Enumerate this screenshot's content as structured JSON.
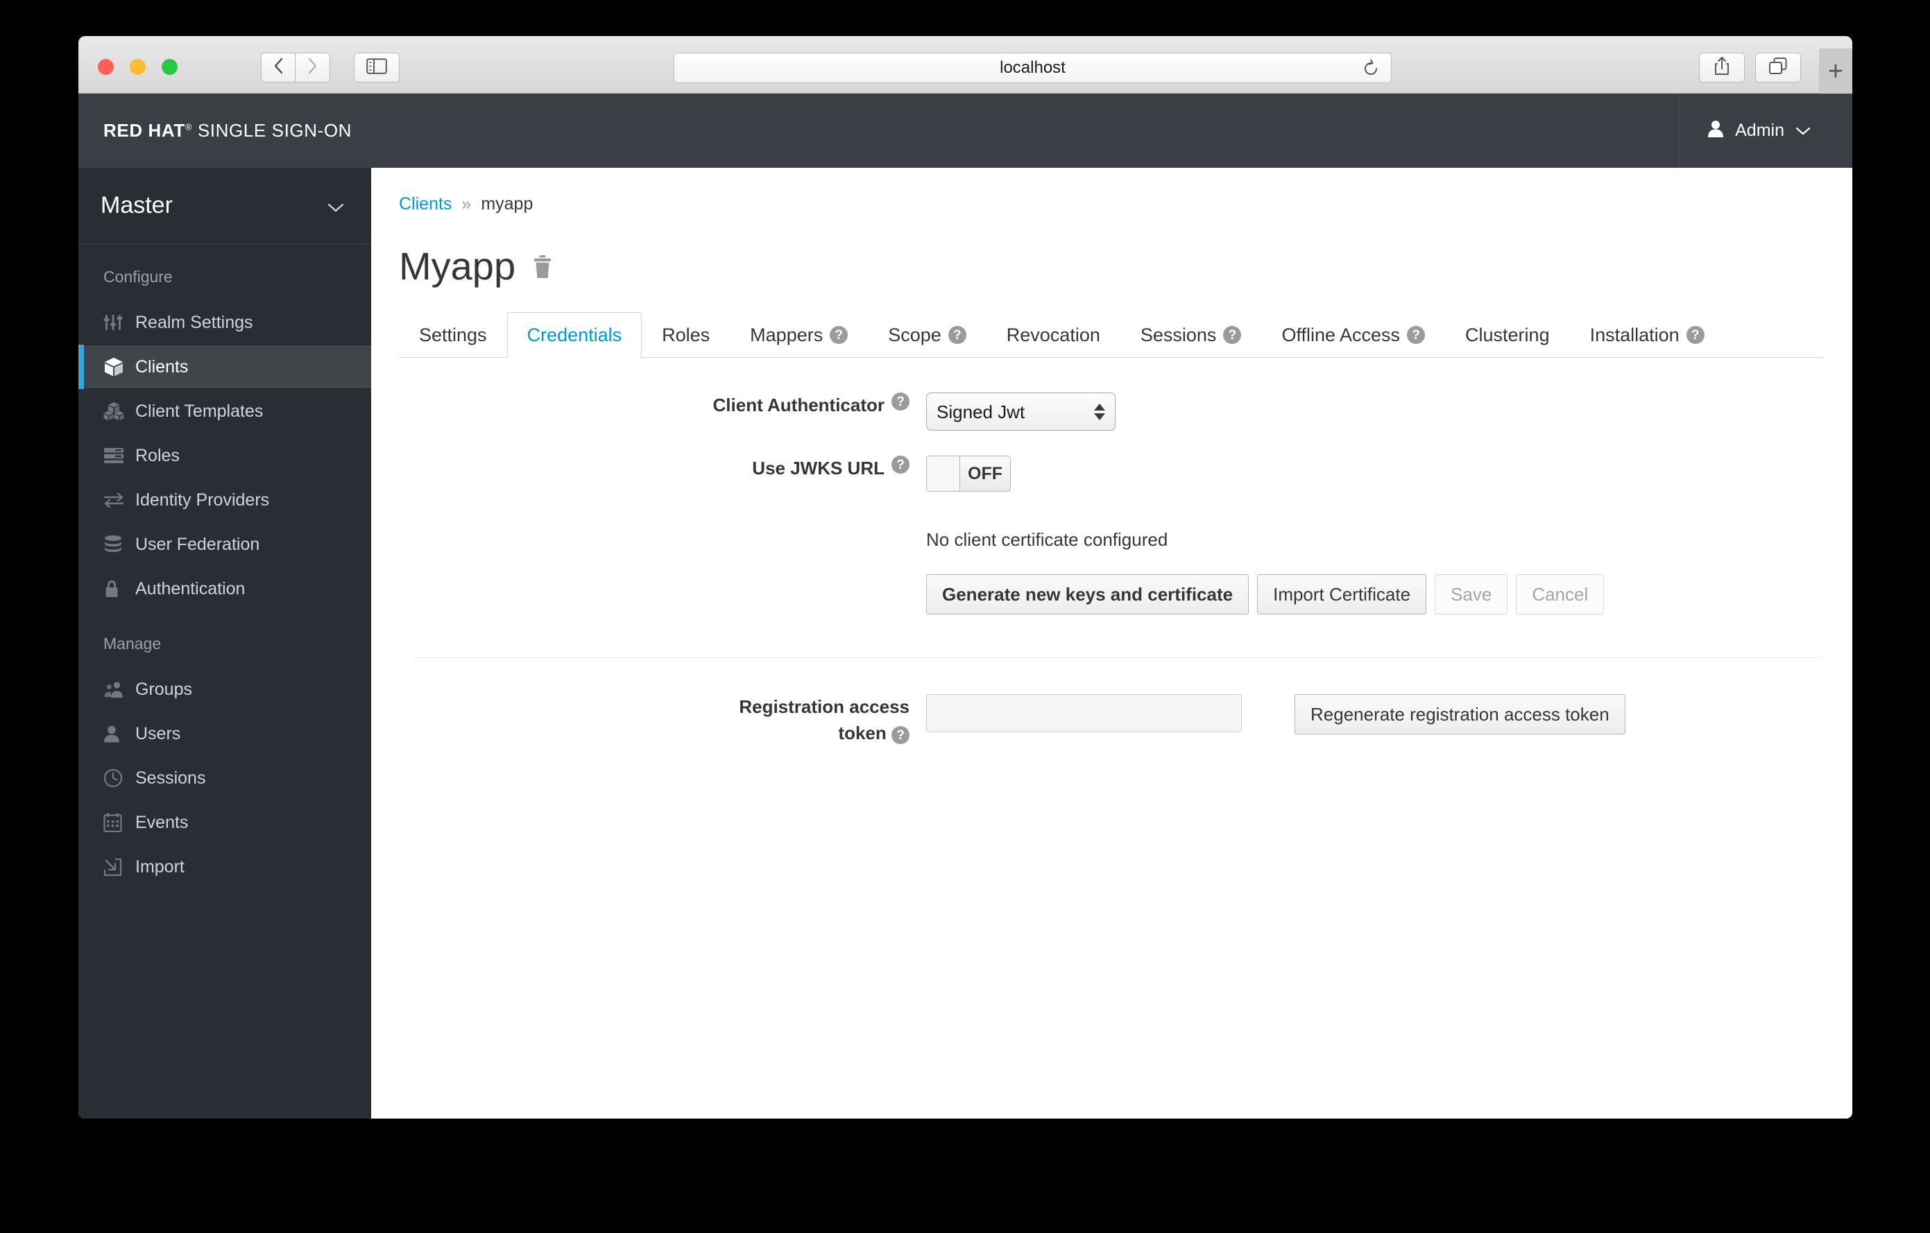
{
  "browser": {
    "url": "localhost",
    "back_icon": "chevron-left-icon",
    "forward_icon": "chevron-right-icon",
    "sidebar_icon": "sidebar-toggle-icon",
    "reload_icon": "reload-icon",
    "share_icon": "share-icon",
    "tabs_icon": "tab-overview-icon",
    "new_tab_label": "+"
  },
  "masthead": {
    "brand_bold": "RED HAT",
    "brand_reg": "®",
    "brand_light": "SINGLE SIGN-ON",
    "user_label": "Admin",
    "user_icon": "user-icon",
    "chevron_icon": "chevron-down-icon"
  },
  "sidebar": {
    "realm": "Master",
    "realm_chevron": "chevron-down-icon",
    "sections": [
      {
        "title": "Configure",
        "items": [
          {
            "label": "Realm Settings",
            "icon": "sliders-icon",
            "active": false
          },
          {
            "label": "Clients",
            "icon": "cube-icon",
            "active": true
          },
          {
            "label": "Client Templates",
            "icon": "cubes-icon",
            "active": false
          },
          {
            "label": "Roles",
            "icon": "list-icon",
            "active": false
          },
          {
            "label": "Identity Providers",
            "icon": "exchange-icon",
            "active": false
          },
          {
            "label": "User Federation",
            "icon": "database-icon",
            "active": false
          },
          {
            "label": "Authentication",
            "icon": "lock-icon",
            "active": false
          }
        ]
      },
      {
        "title": "Manage",
        "items": [
          {
            "label": "Groups",
            "icon": "group-icon",
            "active": false
          },
          {
            "label": "Users",
            "icon": "user-icon",
            "active": false
          },
          {
            "label": "Sessions",
            "icon": "clock-icon",
            "active": false
          },
          {
            "label": "Events",
            "icon": "calendar-icon",
            "active": false
          },
          {
            "label": "Import",
            "icon": "import-icon",
            "active": false
          }
        ]
      }
    ]
  },
  "breadcrumb": {
    "parent": "Clients",
    "separator": "»",
    "current": "myapp"
  },
  "page": {
    "title": "Myapp",
    "delete_icon": "trash-icon"
  },
  "tabs": [
    {
      "label": "Settings",
      "help": false,
      "active": false
    },
    {
      "label": "Credentials",
      "help": false,
      "active": true
    },
    {
      "label": "Roles",
      "help": false,
      "active": false
    },
    {
      "label": "Mappers",
      "help": true,
      "active": false
    },
    {
      "label": "Scope",
      "help": true,
      "active": false
    },
    {
      "label": "Revocation",
      "help": false,
      "active": false
    },
    {
      "label": "Sessions",
      "help": true,
      "active": false
    },
    {
      "label": "Offline Access",
      "help": true,
      "active": false
    },
    {
      "label": "Clustering",
      "help": false,
      "active": false
    },
    {
      "label": "Installation",
      "help": true,
      "active": false
    }
  ],
  "form": {
    "client_authenticator": {
      "label": "Client Authenticator",
      "help": "?",
      "value": "Signed Jwt",
      "options": [
        "Signed Jwt"
      ]
    },
    "use_jwks_url": {
      "label": "Use JWKS URL",
      "help": "?",
      "state": "OFF"
    },
    "certificate_status": "No client certificate configured",
    "buttons": [
      {
        "label": "Generate new keys and certificate",
        "disabled": false,
        "bold": true
      },
      {
        "label": "Import Certificate",
        "disabled": false,
        "bold": false
      },
      {
        "label": "Save",
        "disabled": true,
        "bold": false
      },
      {
        "label": "Cancel",
        "disabled": true,
        "bold": false
      }
    ],
    "registration_token": {
      "label_line1": "Registration access",
      "label_line2": "token",
      "help": "?",
      "value": "",
      "placeholder": "",
      "button_label": "Regenerate registration access token"
    }
  },
  "colors": {
    "masthead_bg": "#393f44",
    "sidebar_bg": "#292e34",
    "accent_blue": "#0099d3",
    "active_bar": "#39a5dc",
    "active_item_bg": "#3f4549"
  }
}
